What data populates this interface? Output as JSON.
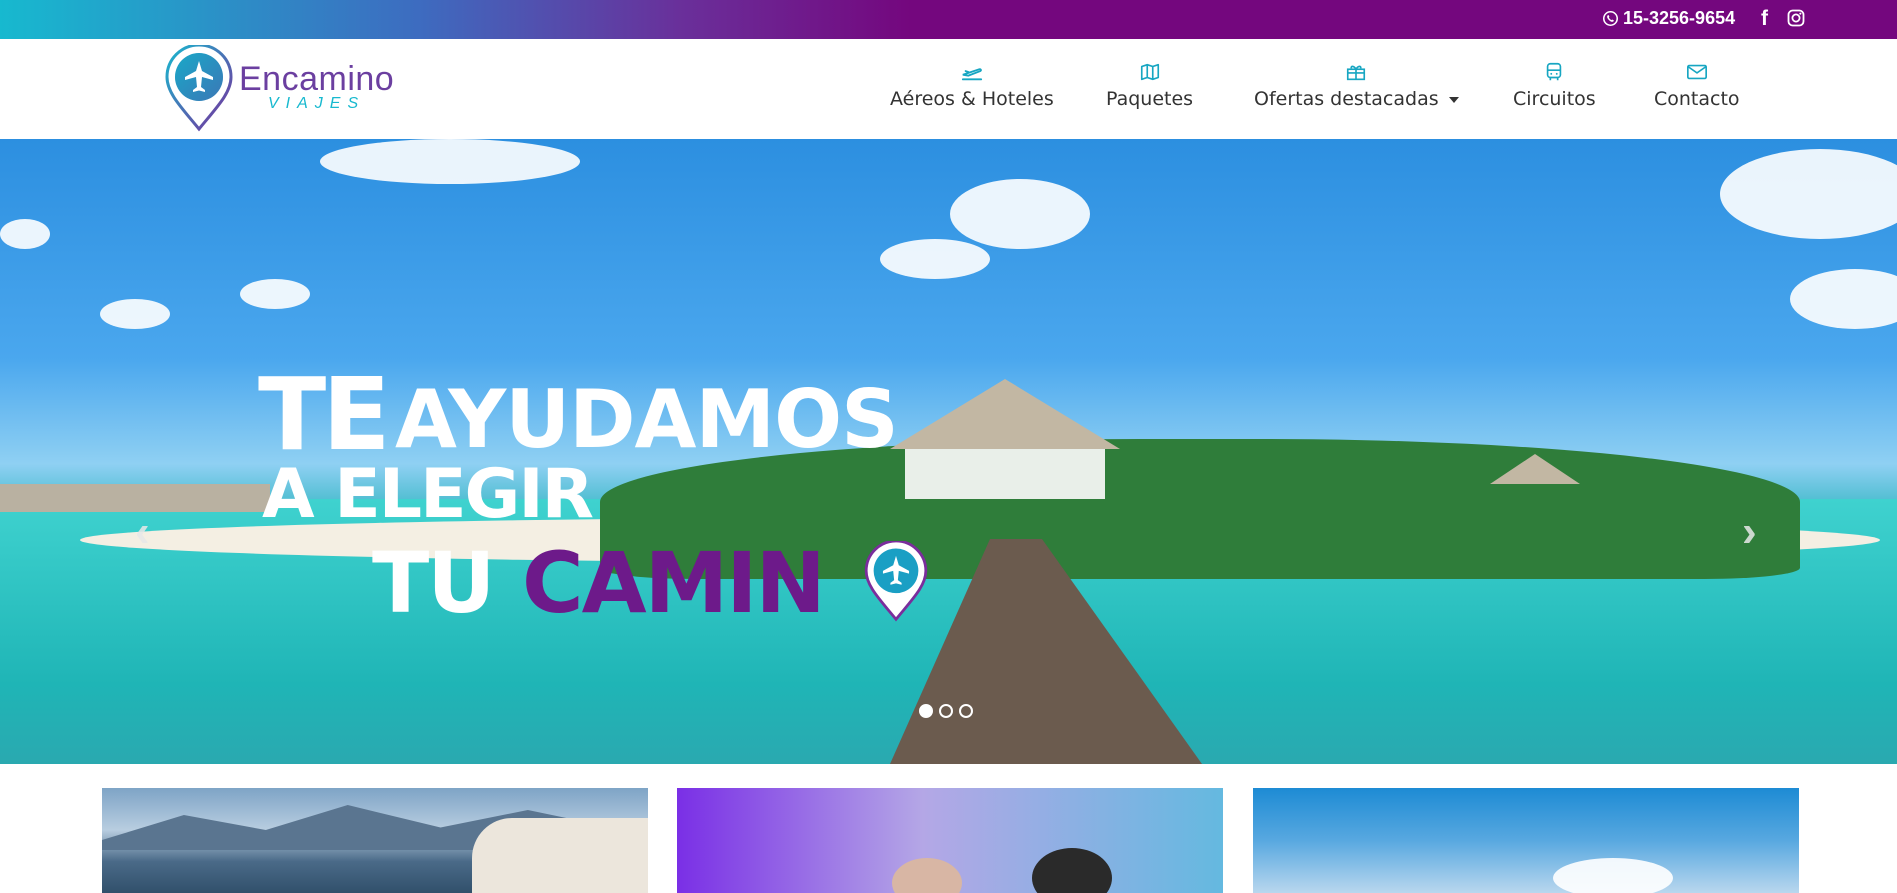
{
  "topbar": {
    "phone": "15-3256-9654",
    "icons": [
      "whatsapp-icon",
      "facebook-icon",
      "instagram-icon"
    ],
    "facebook_glyph": "f"
  },
  "logo": {
    "brand": "Encamino",
    "sub": "VIAJES"
  },
  "nav": [
    {
      "label": "Aéreos & Hoteles",
      "icon": "plane-icon"
    },
    {
      "label": "Paquetes",
      "icon": "map-icon"
    },
    {
      "label": "Ofertas destacadas",
      "icon": "gift-icon",
      "dropdown": true
    },
    {
      "label": "Circuitos",
      "icon": "bus-icon"
    },
    {
      "label": "Contacto",
      "icon": "mail-icon"
    }
  ],
  "hero": {
    "line1a": "TE",
    "line1b": "AYUDAMOS",
    "line2": "A ELEGIR",
    "line3a": "TU",
    "line3b": "CAMIN",
    "prev": "‹",
    "next": "›",
    "slides": 3,
    "active_slide": 1
  },
  "colors": {
    "accent_teal": "#17b9cf",
    "accent_purple": "#74077e",
    "nav_icon": "#17a6c2"
  }
}
